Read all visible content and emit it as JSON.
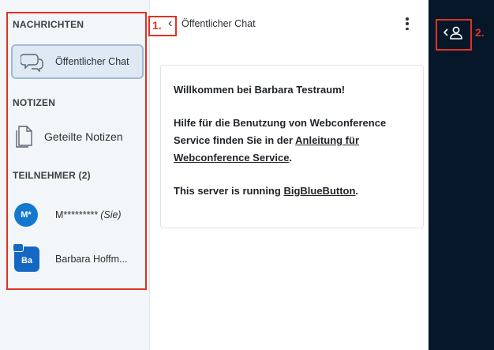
{
  "sidebar": {
    "messages_title": "NACHRICHTEN",
    "public_chat_label": "Öffentlicher Chat",
    "notes_title": "NOTIZEN",
    "shared_notes_label": "Geteilte Notizen",
    "participants_title": "TEILNEHMER (2)",
    "users": [
      {
        "avatar_initials": "M*",
        "name": "M*********",
        "suffix": "(Sie)",
        "avatar_color": "#1478cf"
      },
      {
        "avatar_initials": "Ba",
        "name": "Barbara Hoffm...",
        "suffix": "",
        "avatar_color": "#1468c4"
      }
    ]
  },
  "chat": {
    "back_icon": "chevron-left-icon",
    "title": "Öffentlicher Chat",
    "menu_icon": "kebab-menu-icon",
    "welcome": {
      "greeting_prefix": "Willkommen bei ",
      "room_name": "Barbara Testraum",
      "greeting_suffix": "!",
      "help_text": "Hilfe für die Benutzung von Webconference Service finden Sie in der ",
      "help_link": "Anleitung für Webconference Service",
      "help_end": ".",
      "server_prefix": "This server is running ",
      "server_link": "BigBlueButton",
      "server_end": "."
    }
  },
  "dark_bar": {
    "user_toggle_icon": "user-list-toggle-icon"
  },
  "annotations": {
    "label_1": "1.",
    "label_2": "2.",
    "color": "#e03224"
  },
  "colors": {
    "dark_bar": "#06172a",
    "sidebar_bg": "#f3f6f9",
    "active_item_bg": "#dfe9f4",
    "avatar_blue": "#1478cf"
  }
}
